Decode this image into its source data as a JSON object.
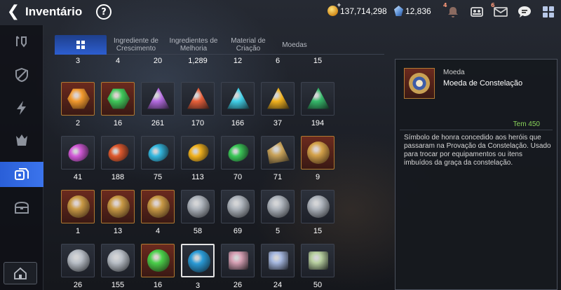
{
  "header": {
    "title": "Inventário",
    "gold": "137,714,298",
    "crystals": "12,836",
    "notification_badge": "4",
    "mail_badge": "6"
  },
  "sidebar": {
    "items": [
      {
        "icon": "hero-equip-icon"
      },
      {
        "icon": "shield-icon"
      },
      {
        "icon": "lightning-icon"
      },
      {
        "icon": "monster-icon"
      },
      {
        "icon": "materials-icon",
        "active": true
      },
      {
        "icon": "chest-icon"
      }
    ],
    "bottom_icon": "house-icon"
  },
  "tabs": [
    {
      "label": "",
      "icon": "grid-icon",
      "active": true
    },
    {
      "label": "Ingrediente de Crescimento"
    },
    {
      "label": "Ingredientes de Melhoria"
    },
    {
      "label": "Material de Criação"
    },
    {
      "label": "Moedas"
    }
  ],
  "partial_row_counts": [
    "3",
    "4",
    "20",
    "1,289",
    "12",
    "6",
    "15"
  ],
  "rows": [
    [
      {
        "count": "2",
        "shape": "hex",
        "color": "#f29a2e",
        "frame": "gold"
      },
      {
        "count": "16",
        "shape": "hex",
        "color": "#3fc85a",
        "frame": "gold"
      },
      {
        "count": "261",
        "shape": "tri",
        "color": "#b46be0",
        "frame": "plain"
      },
      {
        "count": "170",
        "shape": "tri",
        "color": "#e8603a",
        "frame": "plain"
      },
      {
        "count": "166",
        "shape": "tri",
        "color": "#41d0e8",
        "frame": "plain"
      },
      {
        "count": "37",
        "shape": "tri",
        "color": "#f2b21e",
        "frame": "plain"
      },
      {
        "count": "194",
        "shape": "tri",
        "color": "#36b86a",
        "frame": "plain"
      }
    ],
    [
      {
        "count": "41",
        "shape": "oval",
        "color": "#d35ad8",
        "frame": "plain"
      },
      {
        "count": "188",
        "shape": "oval",
        "color": "#e05a2e",
        "frame": "plain"
      },
      {
        "count": "75",
        "shape": "oval",
        "color": "#34b8e0",
        "frame": "plain"
      },
      {
        "count": "113",
        "shape": "oval",
        "color": "#f2b21e",
        "frame": "plain"
      },
      {
        "count": "70",
        "shape": "oval",
        "color": "#3cc858",
        "frame": "plain"
      },
      {
        "count": "71",
        "shape": "tri2",
        "color": "#c9a35a",
        "frame": "plain"
      },
      {
        "count": "9",
        "shape": "round",
        "color": "#d4a24a",
        "frame": "gold"
      }
    ],
    [
      {
        "count": "1",
        "shape": "round",
        "color": "#c99a46",
        "frame": "gold"
      },
      {
        "count": "13",
        "shape": "round",
        "color": "#c99a46",
        "frame": "gold"
      },
      {
        "count": "4",
        "shape": "round",
        "color": "#c99a46",
        "frame": "gold"
      },
      {
        "count": "58",
        "shape": "round",
        "color": "#aeb4bc",
        "frame": "plain"
      },
      {
        "count": "69",
        "shape": "round",
        "color": "#aeb4bc",
        "frame": "plain"
      },
      {
        "count": "5",
        "shape": "round",
        "color": "#aeb4bc",
        "frame": "plain"
      },
      {
        "count": "15",
        "shape": "round",
        "color": "#aeb4bc",
        "frame": "plain"
      }
    ],
    [
      {
        "count": "26",
        "shape": "round",
        "color": "#b8bec6",
        "frame": "plain"
      },
      {
        "count": "155",
        "shape": "round",
        "color": "#b8bec6",
        "frame": "plain"
      },
      {
        "count": "16",
        "shape": "round",
        "color": "#4ad04a",
        "frame": "gold"
      },
      {
        "count": "3",
        "shape": "round",
        "color": "#2a9ad6",
        "frame": "plain",
        "selected": true
      },
      {
        "count": "26",
        "shape": "box",
        "color": "#d6a0b4",
        "frame": "plain"
      },
      {
        "count": "24",
        "shape": "box",
        "color": "#a6b8e0",
        "frame": "plain"
      },
      {
        "count": "50",
        "shape": "box",
        "color": "#b8d0a0",
        "frame": "plain"
      }
    ]
  ],
  "detail": {
    "category": "Moeda",
    "name": "Moeda de Constelação",
    "owned": "Tem 450",
    "description": "Símbolo de honra concedido aos heróis que passaram na Provação da Constelação. Usado para trocar por equipamentos ou itens imbuídos da graça da constelação."
  }
}
